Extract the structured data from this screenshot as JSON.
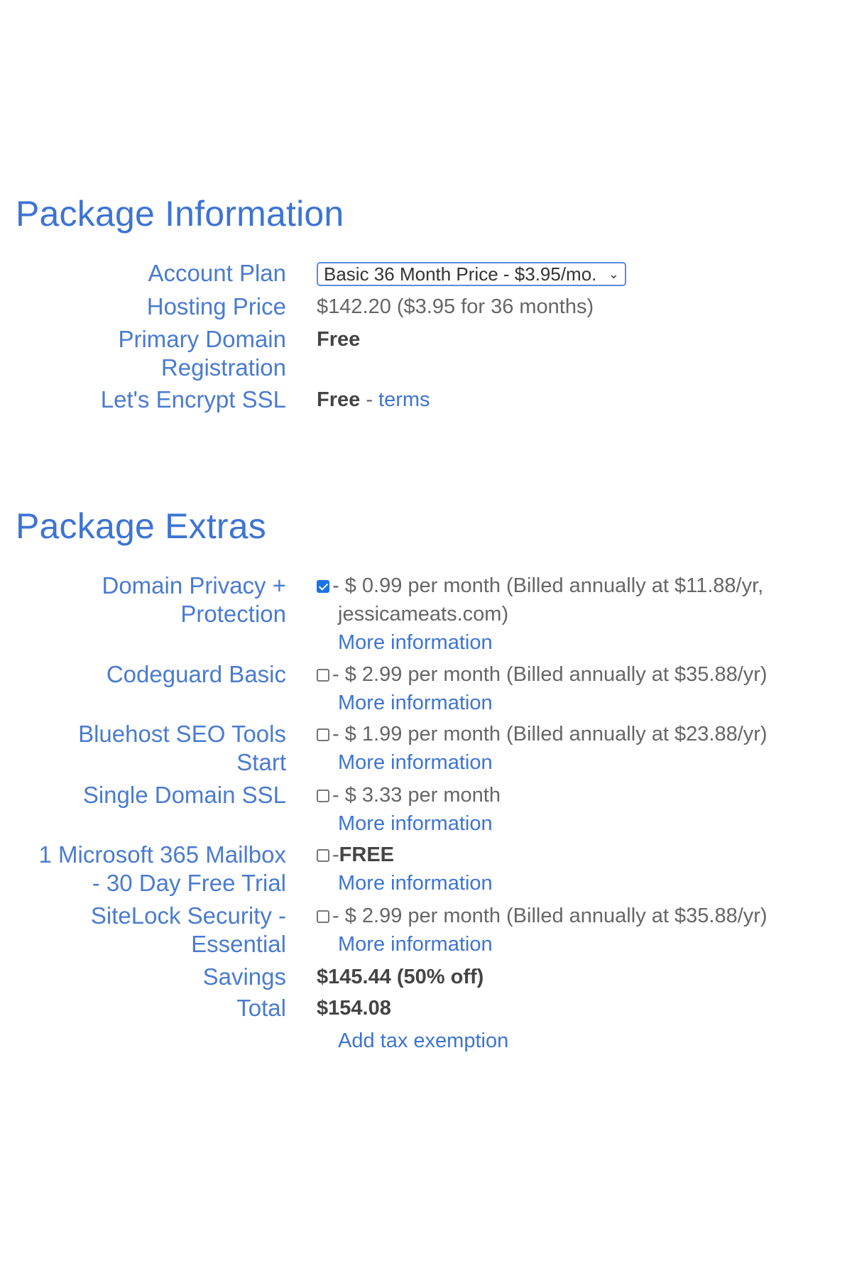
{
  "package_information": {
    "title": "Package Information",
    "account_plan": {
      "label": "Account Plan",
      "selected": "Basic 36 Month Price - $3.95/mo."
    },
    "hosting_price": {
      "label": "Hosting Price",
      "value": "$142.20  ($3.95 for 36 months)"
    },
    "primary_domain": {
      "label_line1": "Primary Domain",
      "label_line2": "Registration",
      "value": "Free"
    },
    "ssl": {
      "label": "Let's Encrypt SSL",
      "value": "Free",
      "separator": " - ",
      "terms_link": "terms"
    }
  },
  "package_extras": {
    "title": "Package Extras",
    "items": [
      {
        "label_line1": "Domain Privacy +",
        "label_line2": "Protection",
        "checked": true,
        "price": "- $ 0.99 per month (Billed annually at $11.88/yr,",
        "price_line2": "jessicameats.com)",
        "more": "More information"
      },
      {
        "label_line1": "Codeguard Basic",
        "label_line2": "",
        "checked": false,
        "price": "- $ 2.99 per month (Billed annually at $35.88/yr)",
        "more": "More information"
      },
      {
        "label_line1": "Bluehost SEO Tools",
        "label_line2": "Start",
        "checked": false,
        "price": "- $ 1.99 per month (Billed annually at $23.88/yr)",
        "more": "More information"
      },
      {
        "label_line1": "Single Domain SSL",
        "label_line2": "",
        "checked": false,
        "price": "- $ 3.33 per month",
        "more": "More information"
      },
      {
        "label_line1": "1 Microsoft 365 Mailbox",
        "label_line2": "- 30 Day Free Trial",
        "checked": false,
        "price_prefix": "-",
        "price_bold": "FREE",
        "more": "More information"
      },
      {
        "label_line1": "SiteLock Security -",
        "label_line2": "Essential",
        "checked": false,
        "price": "- $ 2.99 per month (Billed annually at $35.88/yr)",
        "more": "More information"
      }
    ],
    "savings": {
      "label": "Savings",
      "value": "$145.44 (50% off)"
    },
    "total": {
      "label": "Total",
      "value": "$154.08"
    },
    "tax_link": "Add tax exemption"
  }
}
